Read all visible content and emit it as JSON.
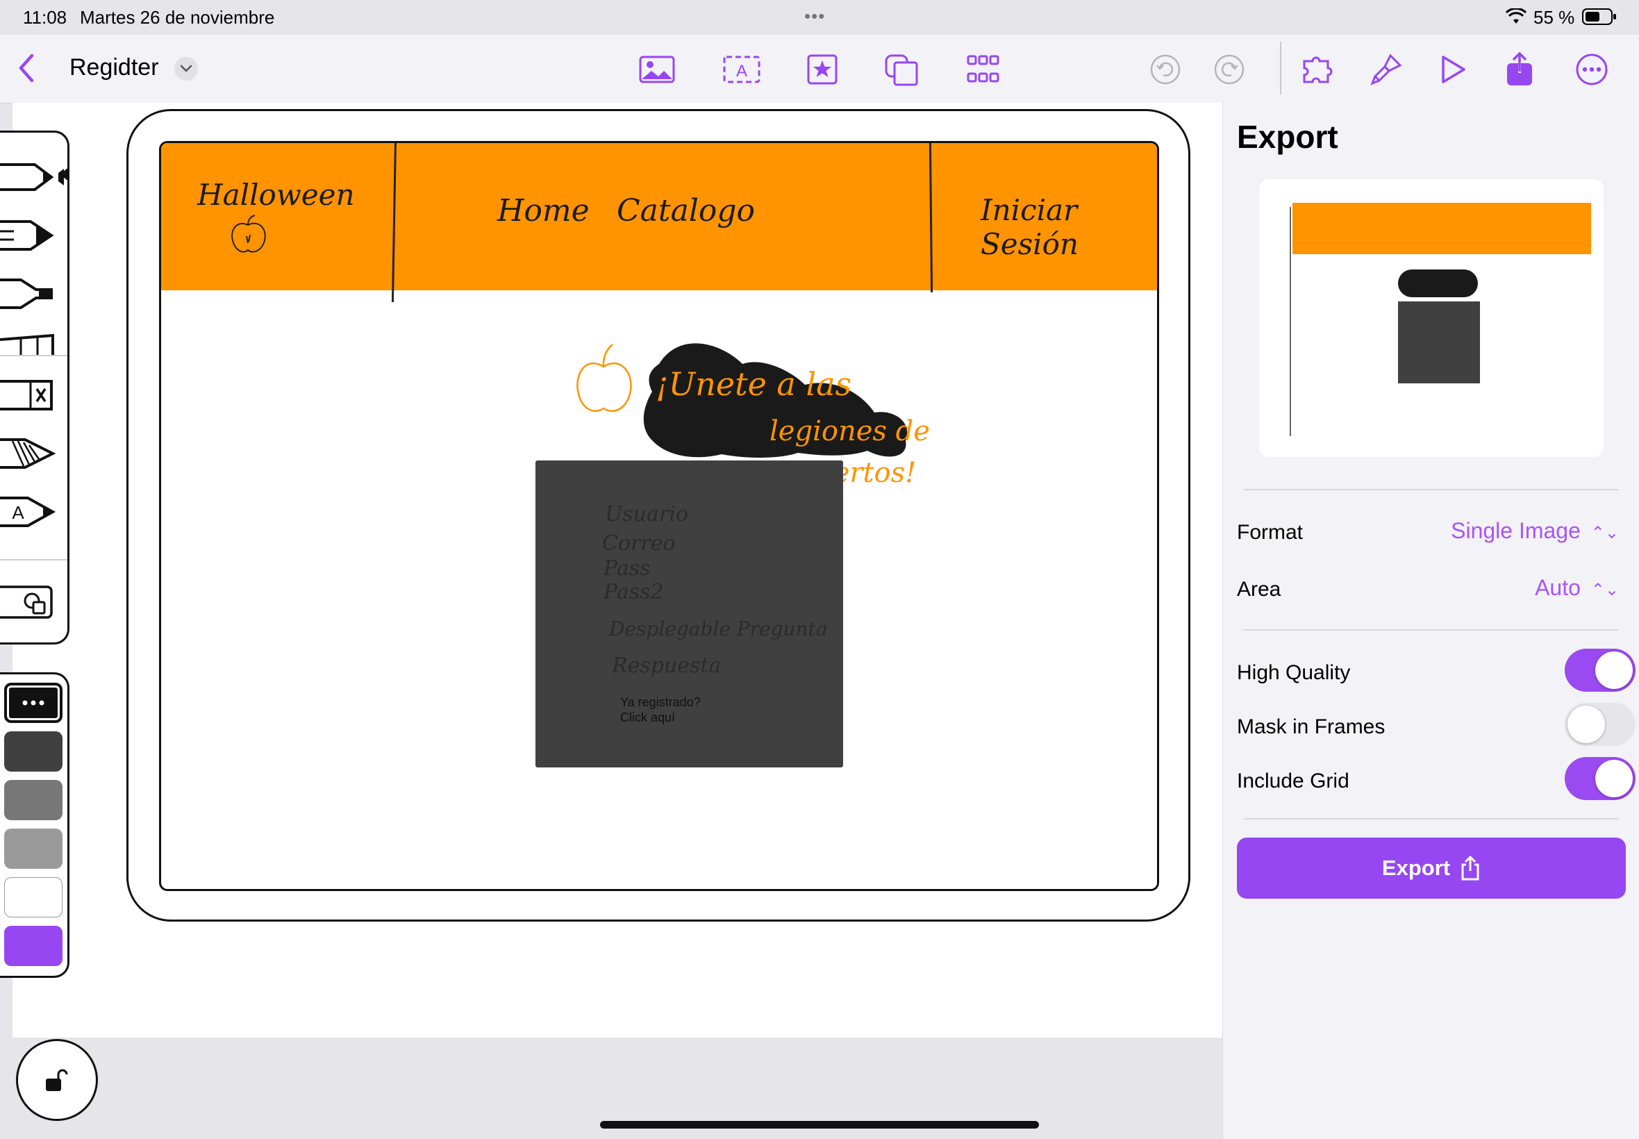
{
  "status_bar": {
    "time": "11:08",
    "date": "Martes 26 de noviembre",
    "dots": "•••",
    "battery_text": "55 %"
  },
  "toolbar": {
    "back_icon": "chevron-left-icon",
    "title": "Regidter",
    "title_menu_icon": "chevron-down-icon",
    "center_tools": [
      "image-icon",
      "text-box-icon",
      "star-icon",
      "shapes-icon",
      "grid-icon"
    ],
    "undo_icon": "undo-icon",
    "redo_icon": "redo-icon",
    "right_tools": [
      "puzzle-icon",
      "brush-icon",
      "play-icon",
      "share-icon",
      "more-icon"
    ],
    "accent_color": "#9747f2"
  },
  "canvas": {
    "sketch": {
      "brand": "Halloween",
      "nav_home": "Home",
      "nav_catalog": "Catalogo",
      "login": "Iniciar Sesión",
      "headline_line1": "¡Unete a las",
      "headline_line2": "legiones de",
      "headline_line3": "muertos!",
      "fields": [
        "Usuario",
        "Correo",
        "Pass",
        "Pass2",
        "Desplegable Pregunta",
        "Respuesta"
      ],
      "login_prompt_line1": "Ya registrado?",
      "login_prompt_line2": "Click aquí",
      "header_color": "#ff9400",
      "box_color": "#404040"
    }
  },
  "palette": {
    "tools": [
      "pen-icon",
      "marker-icon",
      "highlighter-icon",
      "ruler-icon",
      "eraser-icon",
      "lasso-icon",
      "text-pen-icon",
      "shape-recognition-icon"
    ],
    "more_icon": "more-icon",
    "colors": [
      "#404040",
      "#777777",
      "#9a9a9a",
      "#ffffff",
      "#9747f2"
    ]
  },
  "lock_icon": "lock-open-icon",
  "export_panel": {
    "title": "Export",
    "format_label": "Format",
    "format_value": "Single Image",
    "area_label": "Area",
    "area_value": "Auto",
    "high_quality_label": "High Quality",
    "high_quality_on": true,
    "mask_in_frames_label": "Mask in Frames",
    "mask_in_frames_on": false,
    "include_grid_label": "Include Grid",
    "include_grid_on": true,
    "export_button_label": "Export"
  }
}
